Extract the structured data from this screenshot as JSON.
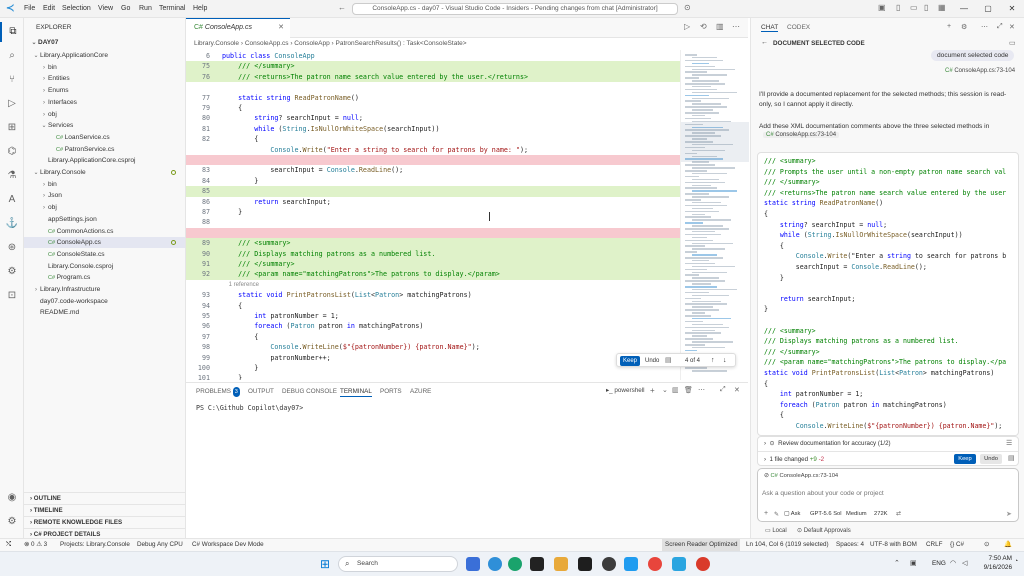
{
  "titlebar": {
    "menus": [
      "File",
      "Edit",
      "Selection",
      "View",
      "Go",
      "Run",
      "Terminal",
      "Help"
    ],
    "command_center": "ConsoleApp.cs - day07 - Visual Studio Code - Insiders - Pending changes from chat [Administrator]"
  },
  "explorer": {
    "header": "EXPLORER",
    "root": "DAY07",
    "items": [
      {
        "label": "Library.ApplicationCore",
        "caret": "⌄",
        "indent": 0
      },
      {
        "label": "bin",
        "caret": "›",
        "indent": 1
      },
      {
        "label": "Entities",
        "caret": "›",
        "indent": 1
      },
      {
        "label": "Enums",
        "caret": "›",
        "indent": 1
      },
      {
        "label": "Interfaces",
        "caret": "›",
        "indent": 1
      },
      {
        "label": "obj",
        "caret": "›",
        "indent": 1
      },
      {
        "label": "Services",
        "caret": "⌄",
        "indent": 1
      },
      {
        "label": "LoanService.cs",
        "caret": "",
        "indent": 2
      },
      {
        "label": "PatronService.cs",
        "caret": "",
        "indent": 2
      },
      {
        "label": "Library.ApplicationCore.csproj",
        "caret": "",
        "indent": 1
      },
      {
        "label": "Library.Console",
        "caret": "⌄",
        "indent": 0
      },
      {
        "label": "bin",
        "caret": "›",
        "indent": 1
      },
      {
        "label": "Json",
        "caret": "›",
        "indent": 1
      },
      {
        "label": "obj",
        "caret": "›",
        "indent": 1
      },
      {
        "label": "appSettings.json",
        "caret": "",
        "indent": 1
      },
      {
        "label": "CommonActions.cs",
        "caret": "",
        "indent": 1
      },
      {
        "label": "ConsoleApp.cs",
        "caret": "",
        "indent": 1
      },
      {
        "label": "ConsoleState.cs",
        "caret": "",
        "indent": 1
      },
      {
        "label": "Library.Console.csproj",
        "caret": "",
        "indent": 1
      },
      {
        "label": "Program.cs",
        "caret": "",
        "indent": 1
      },
      {
        "label": "Library.Infrastructure",
        "caret": "›",
        "indent": 0
      },
      {
        "label": "day07.code-workspace",
        "caret": "",
        "indent": 0
      },
      {
        "label": "README.md",
        "caret": "",
        "indent": 0
      }
    ],
    "sections": [
      "OUTLINE",
      "TIMELINE",
      "REMOTE KNOWLEDGE FILES",
      "C# PROJECT DETAILS"
    ]
  },
  "editor": {
    "tab": "ConsoleApp.cs",
    "breadcrumb": "Library.Console  ›  ConsoleApp.cs  ›  ConsoleApp  ›  PatronSearchResults() : Task<ConsoleState>",
    "reference": "1 reference",
    "lines": [
      {
        "n": "6",
        "t": "public class ConsoleApp",
        "s": ""
      },
      {
        "n": "75",
        "t": "    /// </summary>",
        "s": "add"
      },
      {
        "n": "76",
        "t": "    /// <returns>The patron name search value entered by the user.</returns>",
        "s": "add"
      },
      {
        "n": "",
        "t": "",
        "s": ""
      },
      {
        "n": "77",
        "t": "    static string ReadPatronName()",
        "s": ""
      },
      {
        "n": "79",
        "t": "    {",
        "s": ""
      },
      {
        "n": "80",
        "t": "        string? searchInput = null;",
        "s": ""
      },
      {
        "n": "81",
        "t": "        while (String.IsNullOrWhiteSpace(searchInput))",
        "s": ""
      },
      {
        "n": "82",
        "t": "        {",
        "s": ""
      },
      {
        "n": "",
        "t": "            Console.Write(\"Enter a string to search for patrons by name: \");",
        "s": ""
      },
      {
        "n": "",
        "t": "",
        "s": "del"
      },
      {
        "n": "83",
        "t": "            searchInput = Console.ReadLine();",
        "s": ""
      },
      {
        "n": "84",
        "t": "        }",
        "s": ""
      },
      {
        "n": "85",
        "t": "",
        "s": "add"
      },
      {
        "n": "86",
        "t": "        return searchInput;",
        "s": ""
      },
      {
        "n": "87",
        "t": "    }",
        "s": ""
      },
      {
        "n": "88",
        "t": "",
        "s": ""
      },
      {
        "n": "",
        "t": "",
        "s": "del"
      },
      {
        "n": "89",
        "t": "    /// <summary>",
        "s": "add"
      },
      {
        "n": "90",
        "t": "    /// Displays matching patrons as a numbered list.",
        "s": "add"
      },
      {
        "n": "91",
        "t": "    /// </summary>",
        "s": "add"
      },
      {
        "n": "92",
        "t": "    /// <param name=\"matchingPatrons\">The patrons to display.</param>",
        "s": "add"
      },
      {
        "n": "",
        "t": "    1 reference",
        "s": "ref"
      },
      {
        "n": "93",
        "t": "    static void PrintPatronsList(List<Patron> matchingPatrons)",
        "s": ""
      },
      {
        "n": "94",
        "t": "    {",
        "s": ""
      },
      {
        "n": "95",
        "t": "        int patronNumber = 1;",
        "s": ""
      },
      {
        "n": "96",
        "t": "        foreach (Patron patron in matchingPatrons)",
        "s": ""
      },
      {
        "n": "97",
        "t": "        {",
        "s": ""
      },
      {
        "n": "98",
        "t": "            Console.WriteLine($\"{patronNumber}) {patron.Name}\");",
        "s": ""
      },
      {
        "n": "99",
        "t": "            patronNumber++;",
        "s": ""
      },
      {
        "n": "100",
        "t": "        }",
        "s": ""
      },
      {
        "n": "101",
        "t": "    }",
        "s": ""
      },
      {
        "n": "102",
        "t": "",
        "s": ""
      }
    ],
    "keepbar": {
      "keep": "Keep",
      "undo": "Undo",
      "counter": "4 of 4"
    }
  },
  "panel": {
    "tabs": [
      "PROBLEMS",
      "OUTPUT",
      "DEBUG CONSOLE",
      "TERMINAL",
      "PORTS",
      "AZURE"
    ],
    "problems_count": "3",
    "active_tab": "TERMINAL",
    "shell": "powershell",
    "prompt": "PS C:\\Github Copilot\\day07>"
  },
  "chat": {
    "tabs": [
      "CHAT",
      "CODEX"
    ],
    "title": "DOCUMENT SELECTED CODE",
    "user_message": "document selected code",
    "user_ref": "ConsoleApp.cs:73-104",
    "response_1": "I'll provide a documented replacement for the selected methods; this session is read-only, so I cannot apply it directly.",
    "response_2": "Add these XML documentation comments above the three selected methods in",
    "response_ref": "ConsoleApp.cs:73-104",
    "code": [
      "/// <summary>",
      "/// Prompts the user until a non-empty patron name search val",
      "/// </summary>",
      "/// <returns>The patron name search value entered by the user",
      "static string ReadPatronName()",
      "{",
      "    string? searchInput = null;",
      "    while (String.IsNullOrWhiteSpace(searchInput))",
      "    {",
      "        Console.Write(\"Enter a string to search for patrons b",
      "        searchInput = Console.ReadLine();",
      "    }",
      "",
      "    return searchInput;",
      "}",
      "",
      "/// <summary>",
      "/// Displays matching patrons as a numbered list.",
      "/// </summary>",
      "/// <param name=\"matchingPatrons\">The patrons to display.</pa",
      "static void PrintPatronsList(List<Patron> matchingPatrons)",
      "{",
      "    int patronNumber = 1;",
      "    foreach (Patron patron in matchingPatrons)",
      "    {",
      "        Console.WriteLine($\"{patronNumber}) {patron.Name}\");"
    ],
    "todo": "Review documentation for accuracy (1/2)",
    "files_changed": "1 file changed",
    "added": "+9",
    "removed": "-2",
    "keep": "Keep",
    "undo": "Undo",
    "context_ref": "ConsoleApp.cs:73-104",
    "input_placeholder": "Ask a question about your code or project",
    "mode": "Ask",
    "model": "GPT-5.6 Sol",
    "effort": "Medium",
    "tokens": "272K",
    "location": "Local",
    "approvals": "Default Approvals"
  },
  "status": {
    "errors": "⊗ 0 ⚠ 3",
    "project": "Projects: Library.Console",
    "debug": "Debug Any CPU",
    "devmode": "C# Workspace Dev Mode",
    "screen_reader": "Screen Reader Optimized",
    "position": "Ln 104, Col 6 (1019 selected)",
    "spaces": "Spaces: 4",
    "encoding": "UTF-8 with BOM",
    "eol": "CRLF",
    "lang": "{} C#"
  },
  "taskbar": {
    "search": "Search",
    "lang": "ENG",
    "time": "7:50 AM",
    "date": "9/16/2026"
  },
  "colors": {
    "accent": "#005fb8",
    "added": "#dff2c9",
    "removed": "#f7c9cf"
  }
}
